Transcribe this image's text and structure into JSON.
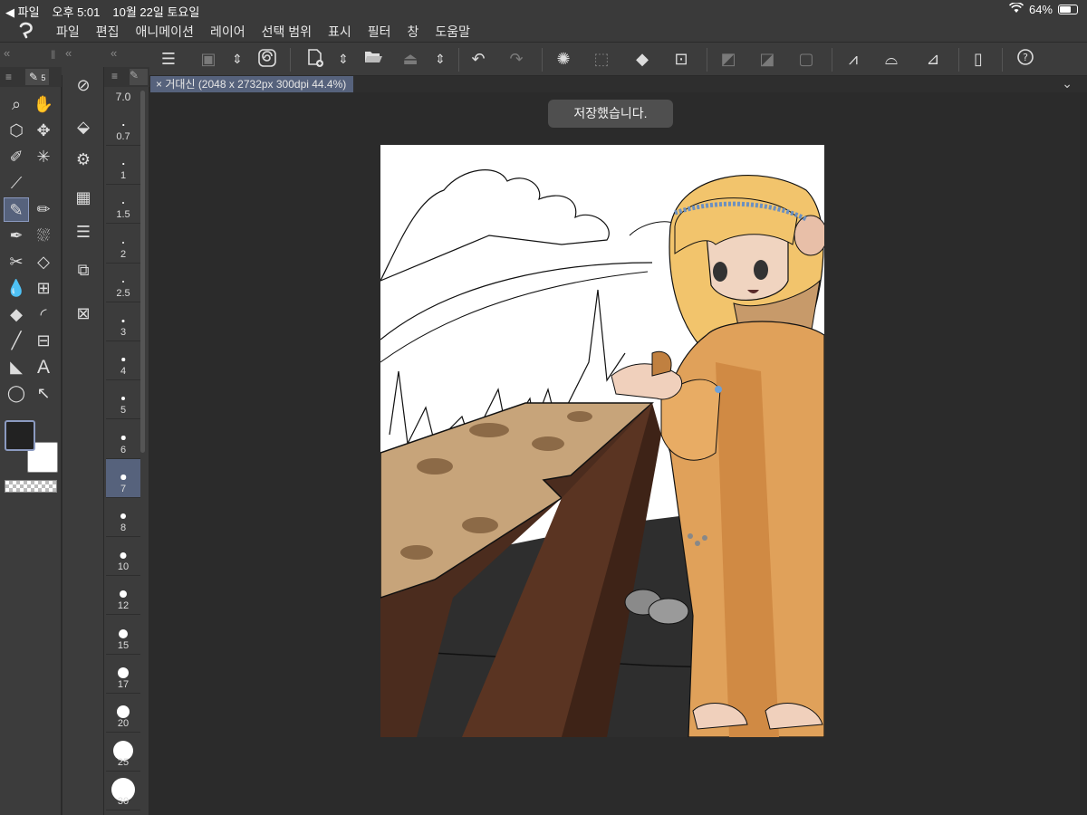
{
  "status_bar": {
    "back_label": "◀ 파일",
    "time": "오후 5:01",
    "date": "10월 22일 토요일",
    "battery": "64%"
  },
  "menu": {
    "items": [
      "파일",
      "편집",
      "애니메이션",
      "레이어",
      "선택 범위",
      "표시",
      "필터",
      "창",
      "도움말"
    ]
  },
  "brush_size": {
    "current": "7.0",
    "sizes": [
      "0.7",
      "1",
      "1.5",
      "2",
      "2.5",
      "3",
      "4",
      "5",
      "6",
      "7",
      "8",
      "10",
      "12",
      "15",
      "17",
      "20",
      "25",
      "30"
    ],
    "selected": "7"
  },
  "document": {
    "tab_label": "거대신 (2048 x 2732px 300dpi 44.4%)"
  },
  "toast": {
    "message": "저장했습니다."
  },
  "colors": {
    "main": "#222222",
    "sub": "#ffffff",
    "accent": "#56627c",
    "background": "#2b2b2b"
  },
  "icons": {
    "commands": [
      "menu-icon",
      "layer-copy-icon",
      "updown-icon",
      "spiral-icon",
      "new-file-icon",
      "open-folder-icon",
      "save-icon",
      "undo-icon",
      "redo-icon",
      "loading-icon",
      "selection-icon",
      "fill-bucket-icon",
      "transform-icon",
      "crop-icon",
      "gradient-icon",
      "frame-icon",
      "vector-icon",
      "brush-tint-icon",
      "ruler-icon",
      "phone-icon",
      "help-icon"
    ]
  }
}
